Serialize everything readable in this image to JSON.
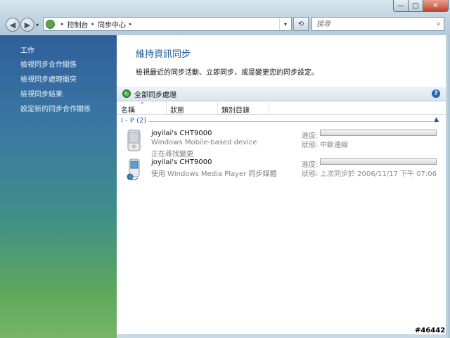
{
  "window": {
    "minimize_glyph": "—",
    "maximize_glyph": "□",
    "close_glyph": "✕"
  },
  "nav": {
    "back_glyph": "◀",
    "forward_glyph": "▶",
    "dropdown_glyph": "▾"
  },
  "address": {
    "crumbs": [
      "控制台",
      "同步中心"
    ],
    "separator": "▸",
    "icon": "sync-center-icon"
  },
  "search": {
    "placeholder": "搜尋",
    "icon": "search-icon"
  },
  "sidebar": {
    "heading": "工作",
    "links": [
      "檢視同步合作關係",
      "檢視同步處理衝突",
      "檢視同步結果",
      "設定新的同步合作關係"
    ]
  },
  "main": {
    "title": "維持資訊同步",
    "description": "檢視最近的同步活動、立即同步，或是變更您的同步設定。",
    "toolbar": {
      "sync_all_label": "全部同步處理",
      "help_glyph": "?"
    },
    "columns": [
      "名稱",
      "狀態",
      "類別目錄"
    ],
    "group": {
      "label": "I - P (2)"
    },
    "items": [
      {
        "name": "joyilai's CHT9000",
        "line1": "Windows Mobile-based device",
        "line2": "正在尋找變更",
        "progress_label": "進度:",
        "progress": 0,
        "status_label": "狀態:",
        "status": "中斷連線",
        "icon": "pda-device-icon"
      },
      {
        "name": "joyilai's CHT9000",
        "line1": "使用 Windows Media Player 同步媒體",
        "line2": "",
        "progress_label": "進度:",
        "progress": 0,
        "status_label": "狀態:",
        "status": "上次同步於 2006/11/17 下午 07:06",
        "icon": "media-player-device-icon"
      }
    ]
  },
  "watermark": "#46442",
  "colors": {
    "accent": "#1e5a96",
    "sidebar_top": "#2f5f9a",
    "sidebar_bottom": "#78b567"
  }
}
